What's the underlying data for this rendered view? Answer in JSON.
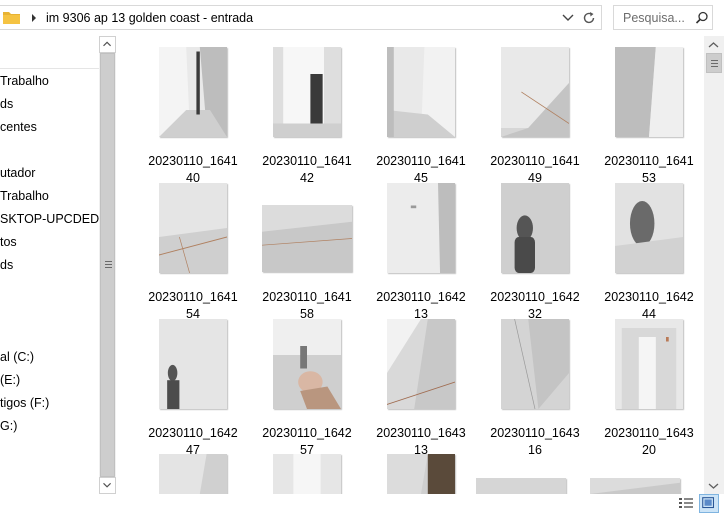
{
  "address_bar": {
    "path_text": "im 9306 ap 13 golden coast - entrada",
    "icons": [
      "folder-icon",
      "chevron-right-icon",
      "chevron-down-icon",
      "refresh-icon"
    ]
  },
  "search": {
    "placeholder": "Pesquisa..."
  },
  "nav_pane": {
    "items": [
      {
        "label": "Trabalho"
      },
      {
        "label": "ds"
      },
      {
        "label": "centes"
      },
      {
        "label": "utador"
      },
      {
        "label": "Trabalho"
      },
      {
        "label": "SKTOP-UPCDEDI"
      },
      {
        "label": "tos"
      },
      {
        "label": "ds"
      },
      {
        "label": "al (C:)"
      },
      {
        "label": "(E:)"
      },
      {
        "label": "tigos (F:)"
      },
      {
        "label": "G:)"
      }
    ]
  },
  "files": [
    {
      "line1": "20230110_1641",
      "line2": "40"
    },
    {
      "line1": "20230110_1641",
      "line2": "42"
    },
    {
      "line1": "20230110_1641",
      "line2": "45"
    },
    {
      "line1": "20230110_1641",
      "line2": "49"
    },
    {
      "line1": "20230110_1641",
      "line2": "53"
    },
    {
      "line1": "20230110_1641",
      "line2": "54"
    },
    {
      "line1": "20230110_1641",
      "line2": "58"
    },
    {
      "line1": "20230110_1642",
      "line2": "13"
    },
    {
      "line1": "20230110_1642",
      "line2": "32"
    },
    {
      "line1": "20230110_1642",
      "line2": "44"
    },
    {
      "line1": "20230110_1642",
      "line2": "47"
    },
    {
      "line1": "20230110_1642",
      "line2": "57"
    },
    {
      "line1": "20230110_1643",
      "line2": "13"
    },
    {
      "line1": "20230110_1643",
      "line2": "16"
    },
    {
      "line1": "20230110_1643",
      "line2": "20"
    }
  ],
  "view_buttons": {
    "icons": [
      "details-view-icon",
      "large-icons-view-icon"
    ],
    "selected": "large-icons-view-icon"
  },
  "colors": {
    "selected_view_bg": "#cce4f7",
    "folder_yellow": "#f5c342",
    "scrollbar_bg": "#f0f0f0"
  }
}
